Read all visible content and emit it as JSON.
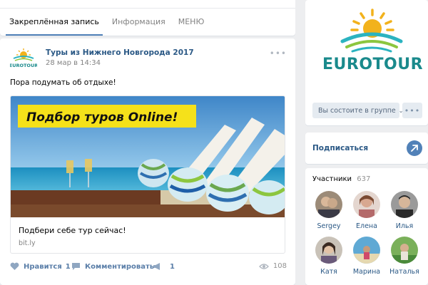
{
  "tabs": [
    {
      "label": "Закреплённая запись",
      "active": true
    },
    {
      "label": "Информация",
      "active": false
    },
    {
      "label": "МЕНЮ",
      "active": false
    }
  ],
  "post": {
    "author": "Туры из Нижнего Новгорода 2017",
    "date": "28 мар в 14:34",
    "text": "Пора подумать об отдыхе!",
    "more_glyph": "•••",
    "logo_word": "EUROTOUR",
    "snippet": {
      "banner_text": "Подбор туров Online!",
      "title": "Подбери себе тур сейчас!",
      "domain": "bit.ly"
    },
    "actions": {
      "like_label": "Нравится",
      "like_count": "1",
      "comment_label": "Комментировать",
      "share_count": "1",
      "views": "108"
    }
  },
  "group": {
    "brand": "EUROTOUR",
    "membership_button": "Вы состоите в группе",
    "more_glyph": "•••",
    "subscribe_label": "Подписаться"
  },
  "members": {
    "title": "Участники",
    "count": "637",
    "list": [
      {
        "name": "Sergey",
        "color": "#8a7a6a"
      },
      {
        "name": "Елена",
        "color": "#b88a8a"
      },
      {
        "name": "Илья",
        "color": "#5a5a5a"
      },
      {
        "name": "Катя",
        "color": "#7a6a5a"
      },
      {
        "name": "Марина",
        "color": "#6a9ab8"
      },
      {
        "name": "Наталья",
        "color": "#7aa86a"
      }
    ]
  },
  "colors": {
    "link": "#2a5885",
    "accent": "#5181b8",
    "banner_yellow": "#f5e11a",
    "brand_teal": "#1a8a8c"
  }
}
